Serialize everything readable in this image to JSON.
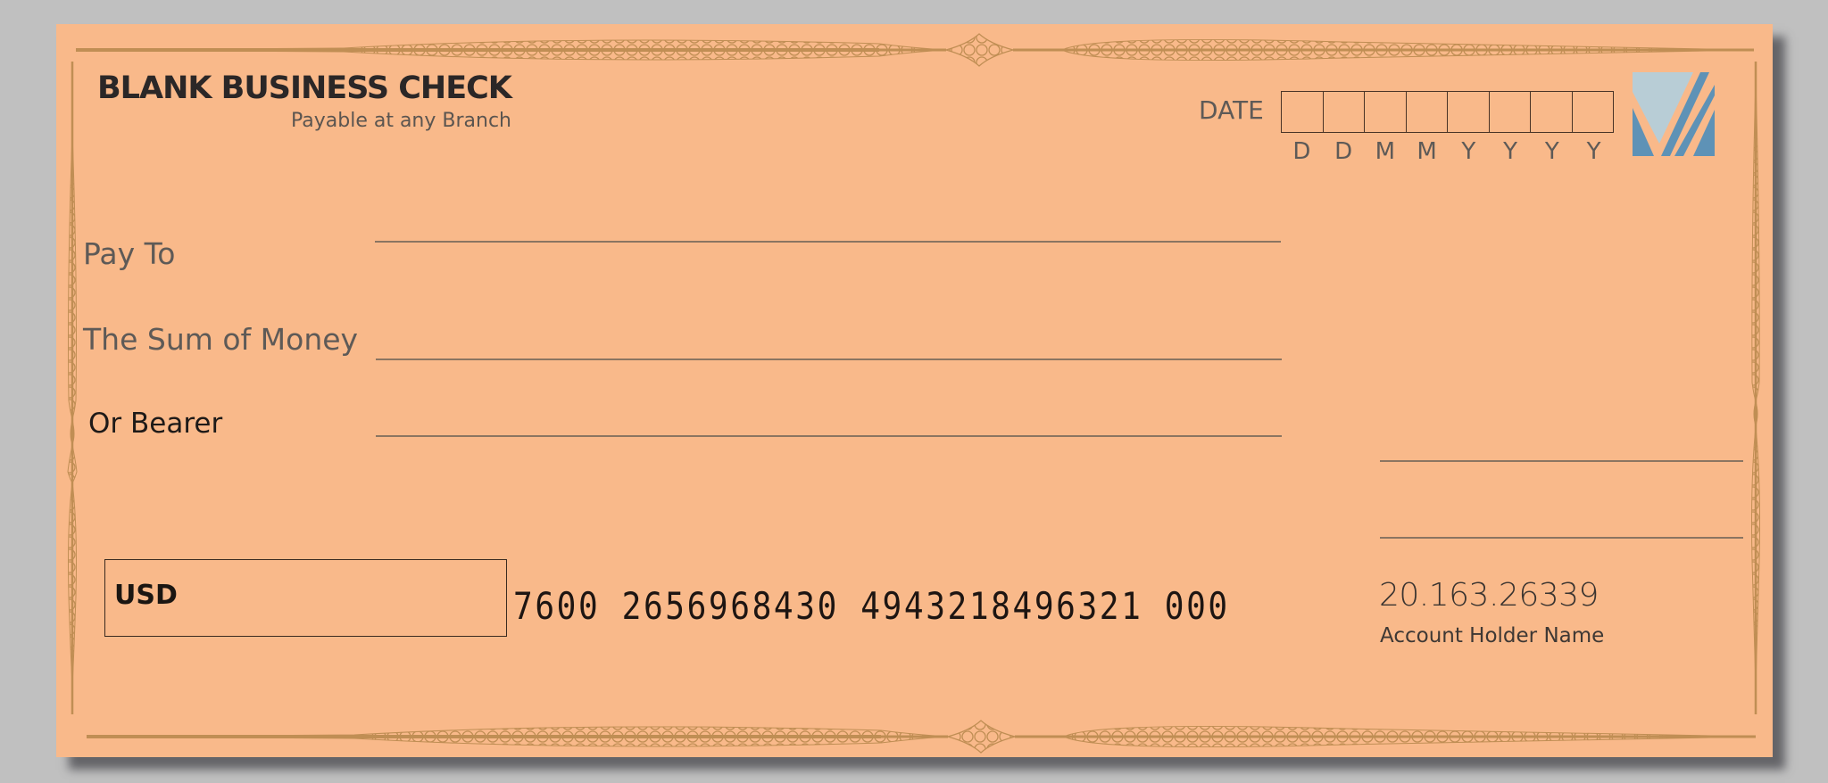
{
  "check": {
    "title": "BLANK BUSINESS CHECK",
    "subtitle": "Payable at any Branch",
    "date": {
      "label": "DATE",
      "format_letters": [
        "D",
        "D",
        "M",
        "M",
        "Y",
        "Y",
        "Y",
        "Y"
      ],
      "values": [
        "",
        "",
        "",
        "",
        "",
        "",
        "",
        ""
      ]
    },
    "fields": {
      "pay_to": {
        "label": "Pay To",
        "value": ""
      },
      "sum_of_money": {
        "label": "The Sum of Money",
        "value": ""
      },
      "or_bearer": {
        "label": "Or Bearer",
        "value": ""
      }
    },
    "amount_box": {
      "currency": "USD",
      "value": ""
    },
    "micr_line": "7600 2656968430 4943218496321 000",
    "account_number": "20.163.26339",
    "account_holder_label": "Account Holder Name",
    "signature_lines": 2,
    "logo": "bank-logo-icon"
  },
  "colors": {
    "paper": "#f9b98a",
    "border_ornament": "#c08e54",
    "background": "#c0c0c0",
    "logo_light": "#b8cdd6",
    "logo_dark": "#5e92b6",
    "text_dark": "#2b2727",
    "text_gray": "#5e5a57"
  }
}
